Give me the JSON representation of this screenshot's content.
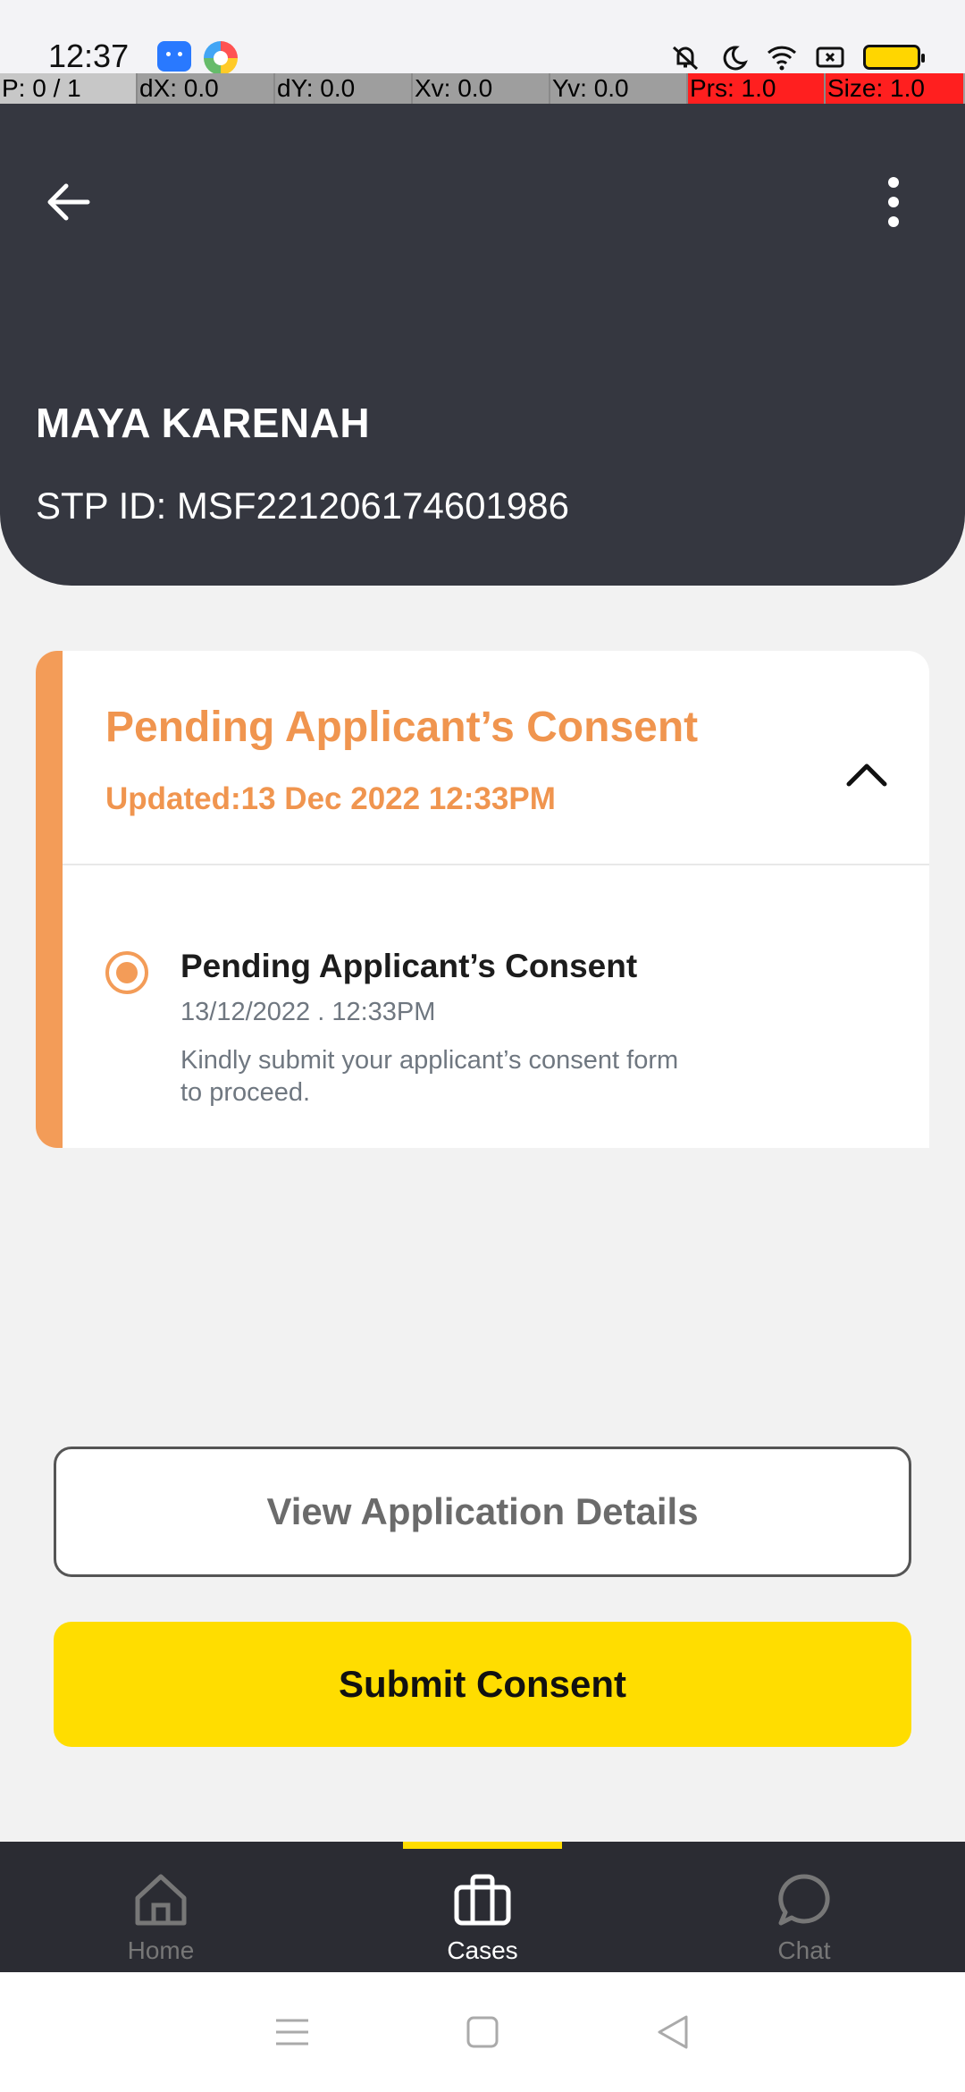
{
  "status_bar": {
    "time": "12:37",
    "icons": [
      "android-notification-icon",
      "browser-notification-icon",
      "mute-icon",
      "do-not-disturb-icon",
      "wifi-icon",
      "screen-record-icon",
      "battery-icon"
    ]
  },
  "debug_bar": {
    "p": "P: 0 / 1",
    "dx": "dX: 0.0",
    "dy": "dY: 0.0",
    "xv": "Xv: 0.0",
    "yv": "Yv: 0.0",
    "prs": "Prs: 1.0",
    "size": "Size: 1.0"
  },
  "header": {
    "name": "MAYA KARENAH",
    "stp_id": "STP ID: MSF221206174601986"
  },
  "status_card": {
    "title": "Pending Applicant’s Consent",
    "updated": "Updated:13 Dec 2022 12:33PM",
    "accent_color": "#f39c58",
    "step": {
      "title": "Pending Applicant’s Consent",
      "date": "13/12/2022 . 12:33PM",
      "description": "Kindly submit your applicant’s consent form to proceed."
    }
  },
  "actions": {
    "view_details": "View Application Details",
    "submit": "Submit Consent"
  },
  "bottom_nav": {
    "items": [
      {
        "label": "Home",
        "icon": "home-icon",
        "active": false
      },
      {
        "label": "Cases",
        "icon": "briefcase-icon",
        "active": true
      },
      {
        "label": "Chat",
        "icon": "chat-bubble-icon",
        "active": false
      }
    ],
    "active_color": "#ffdd00"
  },
  "system_nav": [
    "menu-icon",
    "home-square-icon",
    "back-triangle-icon"
  ]
}
